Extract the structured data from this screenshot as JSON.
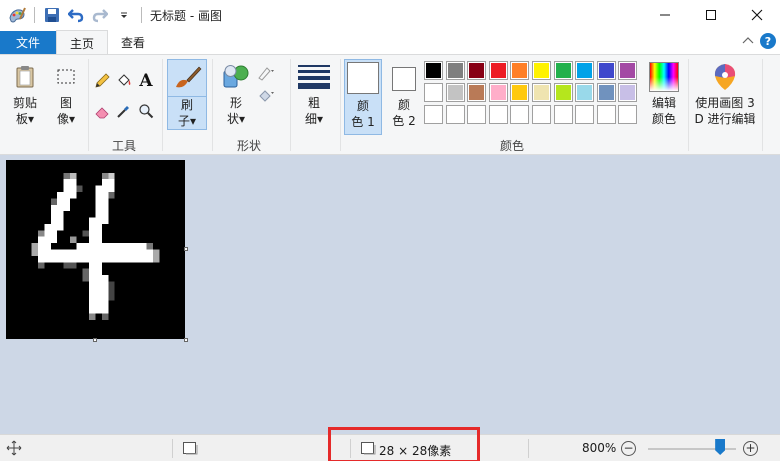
{
  "window": {
    "title": "无标题 - 画图"
  },
  "tabs": {
    "file": "文件",
    "home": "主页",
    "view": "查看"
  },
  "ribbon": {
    "clipboard": {
      "line1": "剪贴",
      "line2": "板▾"
    },
    "image": {
      "line1": "图",
      "line2": "像▾"
    },
    "tools_label": "工具",
    "brush": {
      "line1": "刷",
      "line2": "子▾"
    },
    "shapes": {
      "line1": "形",
      "line2": "状▾"
    },
    "shapes_label": "形状",
    "size": {
      "line1": "粗",
      "line2": "细▾"
    },
    "color1": {
      "line1": "颜",
      "line2": "色 1"
    },
    "color2": {
      "line1": "颜",
      "line2": "色 2"
    },
    "colors_label": "颜色",
    "edit_colors": {
      "line1": "编辑",
      "line2": "颜色"
    },
    "paint3d": {
      "line1": "使用画图 3",
      "line2": "D 进行编辑"
    },
    "text_tool_glyph": "A",
    "palette_row1": [
      "#000000",
      "#7f7f7f",
      "#880015",
      "#ed1c24",
      "#ff7f27",
      "#fff200",
      "#22b14c",
      "#00a2e8",
      "#3f48cc",
      "#a349a4"
    ],
    "palette_row2": [
      "#ffffff",
      "#c3c3c3",
      "#b97a57",
      "#ffaec9",
      "#ffc90e",
      "#efe4b0",
      "#b5e61d",
      "#99d9ea",
      "#7092be",
      "#c8bfe7"
    ],
    "color1_value": "#ffffff",
    "color2_value": "#ffffff"
  },
  "canvas": {
    "background": "#000000",
    "glyph": "4",
    "size_px": "28"
  },
  "status": {
    "image_size": "28 × 28像素",
    "zoom": "800%",
    "zoom_level_fraction": 0.82
  }
}
